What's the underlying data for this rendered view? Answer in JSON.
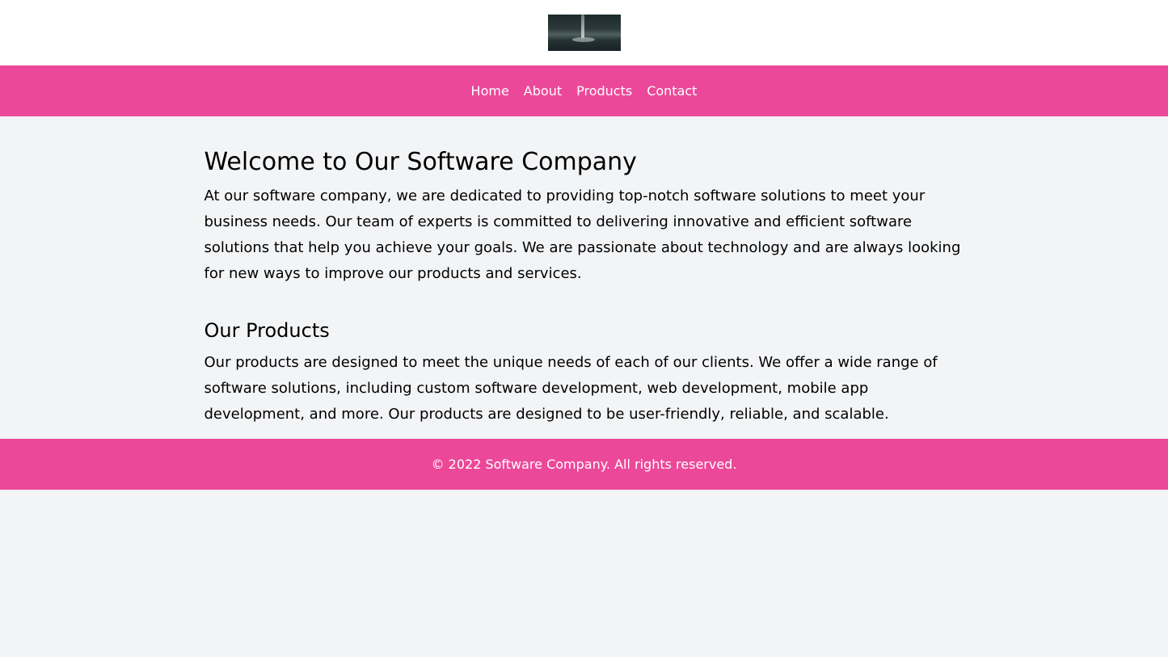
{
  "colors": {
    "accent": "#ec4899",
    "background": "#f3f4f6",
    "header_bg": "#ffffff",
    "text": "#000000",
    "footer_text": "#ffffff"
  },
  "header": {
    "logo_icon": "logo-image-icon"
  },
  "nav": {
    "items": [
      {
        "label": "Home"
      },
      {
        "label": "About"
      },
      {
        "label": "Products"
      },
      {
        "label": "Contact"
      }
    ]
  },
  "main": {
    "welcome": {
      "title": "Welcome to Our Software Company",
      "body": "At our software company, we are dedicated to providing top-notch software solutions to meet your business needs. Our team of experts is committed to delivering innovative and efficient software solutions that help you achieve your goals. We are passionate about technology and are always looking for new ways to improve our products and services."
    },
    "products": {
      "title": "Our Products",
      "body": "Our products are designed to meet the unique needs of each of our clients. We offer a wide range of software solutions, including custom software development, web development, mobile app development, and more. Our products are designed to be user-friendly, reliable, and scalable."
    }
  },
  "footer": {
    "copyright": "© 2022 Software Company. All rights reserved."
  }
}
